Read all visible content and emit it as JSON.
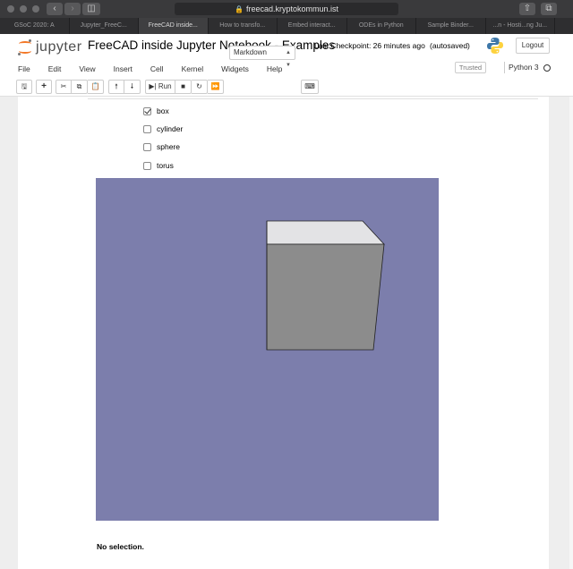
{
  "browser": {
    "url": "freecad.kryptokommun.ist",
    "tabs": [
      {
        "label": "GSoC 2020: A"
      },
      {
        "label": "Jupyter_FreeC..."
      },
      {
        "label": "FreeCAD inside..."
      },
      {
        "label": "How to transfo..."
      },
      {
        "label": "Embed interact..."
      },
      {
        "label": "ODEs in Python"
      },
      {
        "label": "Sample Binder..."
      },
      {
        "label": "...n - Hosti...ng Ju..."
      }
    ]
  },
  "header": {
    "logo_text": "jupyter",
    "notebook_title": "FreeCAD inside Jupyter Notebook - Examples",
    "checkpoint": "Last Checkpoint: 26 minutes ago",
    "autosave_status": "(autosaved)",
    "logout_label": "Logout",
    "trusted_label": "Trusted",
    "kernel_name": "Python 3"
  },
  "menu": {
    "items": [
      "File",
      "Edit",
      "View",
      "Insert",
      "Cell",
      "Kernel",
      "Widgets",
      "Help"
    ]
  },
  "toolbar": {
    "run_label": "Run",
    "cell_type": "Markdown"
  },
  "widget": {
    "options": [
      {
        "label": "box",
        "checked": true
      },
      {
        "label": "cylinder",
        "checked": false
      },
      {
        "label": "sphere",
        "checked": false
      },
      {
        "label": "torus",
        "checked": false
      }
    ],
    "viewer_background": "#7c7eac",
    "selection_status": "No selection."
  }
}
